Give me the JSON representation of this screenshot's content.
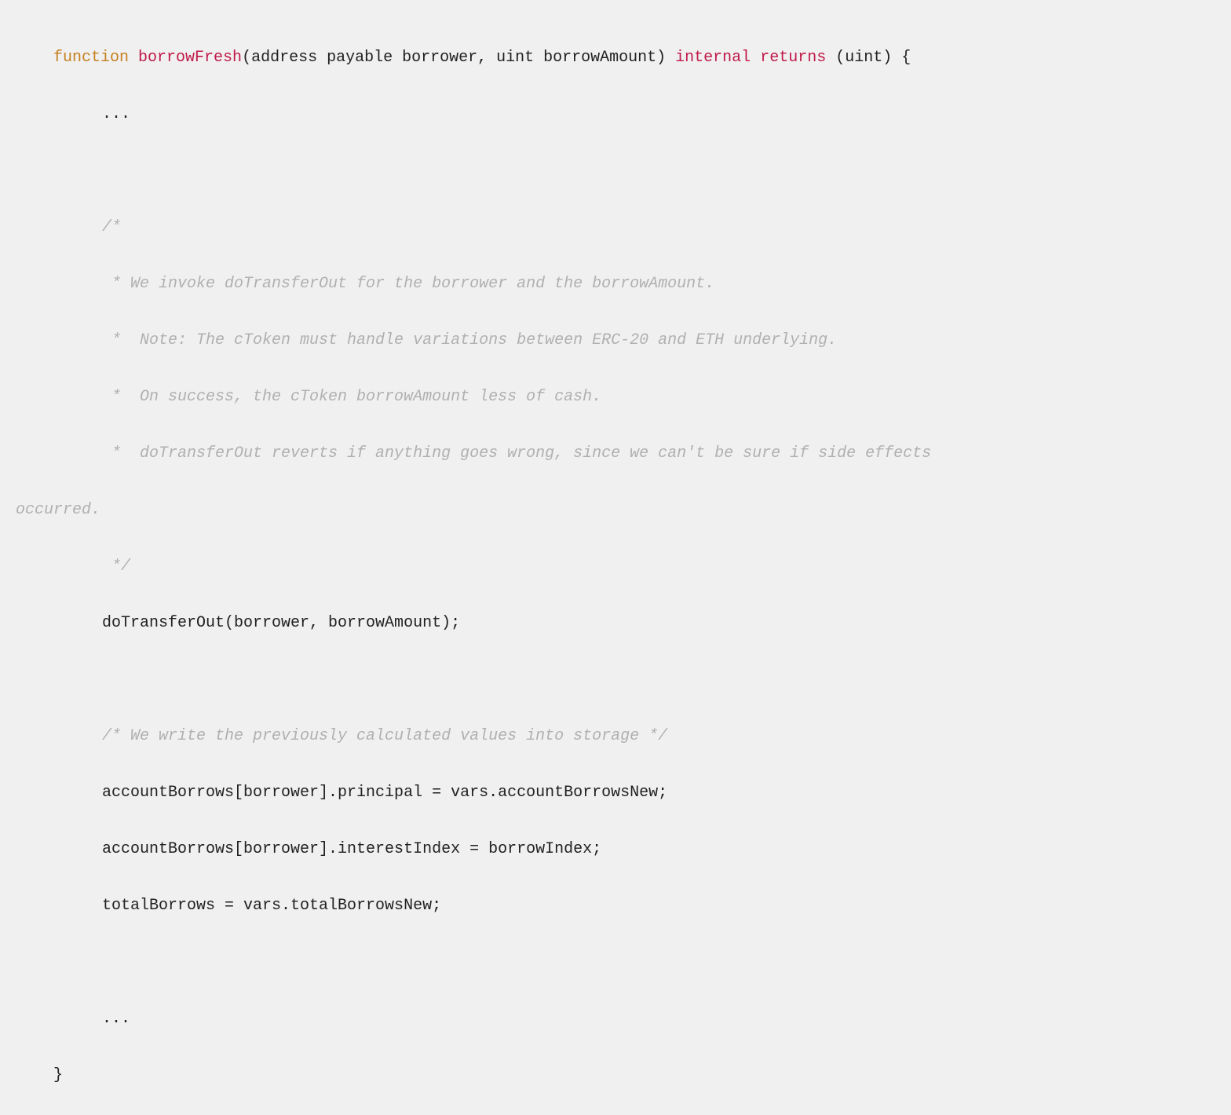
{
  "code": {
    "line1": {
      "keyword": "function",
      "funcName": "borrowFresh",
      "params": "(address payable borrower, uint borrowAmount) ",
      "mod1": "internal",
      "mod2": "returns",
      "tail": " (uint) {"
    },
    "line2": "...",
    "commentBlock": {
      "l1": "/*",
      "l2": " * We invoke doTransferOut for the borrower and the borrowAmount.",
      "l3": " *  Note: The cToken must handle variations between ERC-20 and ETH underlying.",
      "l4": " *  On success, the cToken borrowAmount less of cash.",
      "l5": " *  doTransferOut reverts if anything goes wrong, since we can't be sure if side effects ",
      "l5b": "occurred.",
      "l6": " */"
    },
    "line8": "doTransferOut(borrower, borrowAmount);",
    "comment2": "/* We write the previously calculated values into storage */",
    "line10": "accountBorrows[borrower].principal = vars.accountBorrowsNew;",
    "line11": "accountBorrows[borrower].interestIndex = borrowIndex;",
    "line12": "totalBorrows = vars.totalBorrowsNew;",
    "line13": "...",
    "line14": "}"
  }
}
